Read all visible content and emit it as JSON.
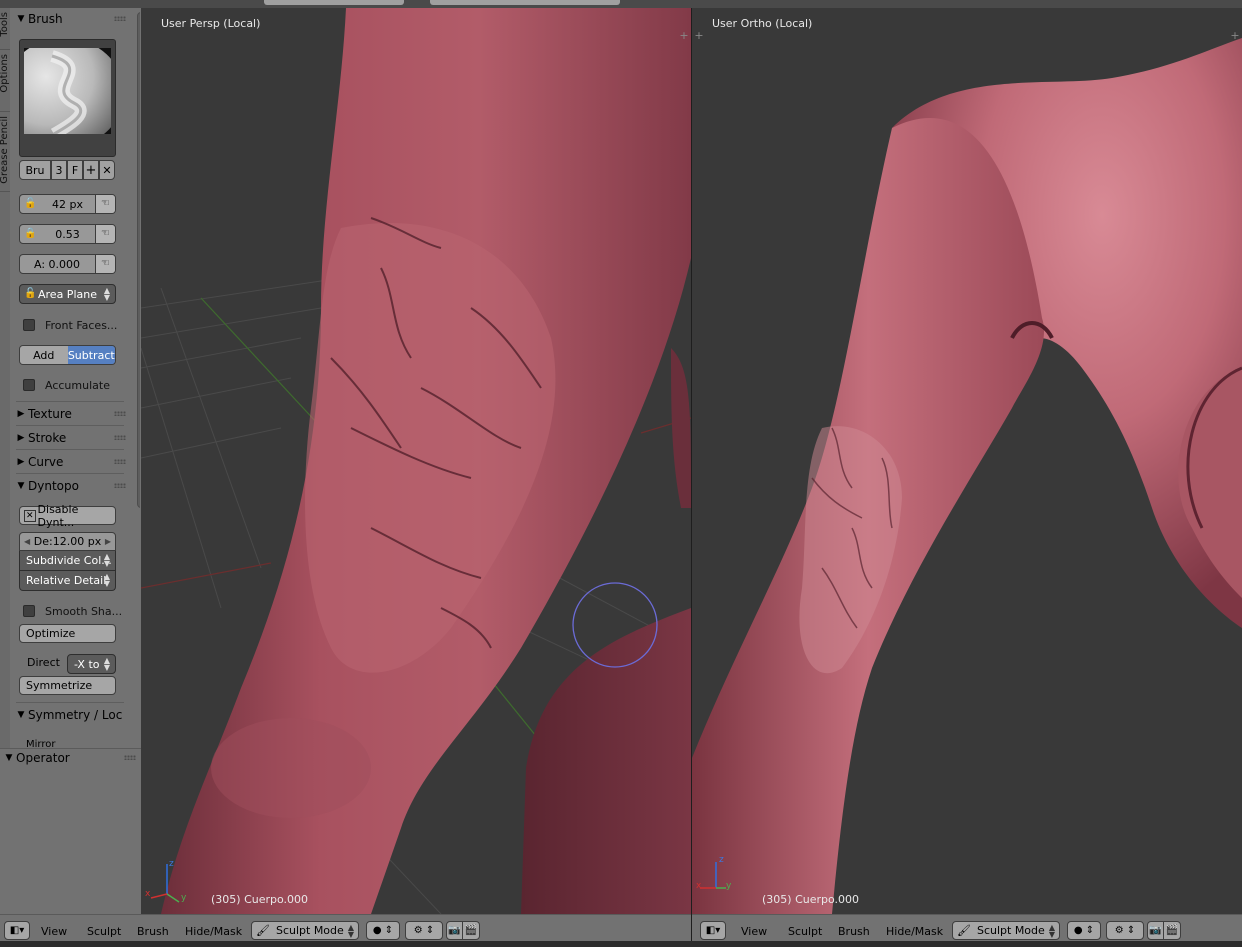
{
  "side_tabs": [
    "Tools",
    "Options",
    "Grease Pencil"
  ],
  "brush_panel": {
    "title": "Brush",
    "brush_name_short": "Bru",
    "users": "3",
    "fake_user": "F",
    "radius": "42 px",
    "strength": "0.53",
    "autosmooth": "A:  0.000",
    "sculpt_plane": "Area Plane",
    "front_faces_label": "Front Faces...",
    "add_label": "Add",
    "subtract_label": "Subtract",
    "accumulate_label": "Accumulate"
  },
  "collapsed_panels": [
    "Texture",
    "Stroke",
    "Curve"
  ],
  "dyntopo": {
    "title": "Dyntopo",
    "disable_label": "Disable Dynt...",
    "detail_size": "De:12.00 px",
    "method": "Subdivide Col...",
    "detail_type": "Relative Detail",
    "smooth_shading_label": "Smooth Sha...",
    "optimize_label": "Optimize",
    "direction_label": "Direct",
    "direction_value": "-X to",
    "symmetrize_label": "Symmetrize"
  },
  "symmetry_panel": {
    "title": "Symmetry / Loc",
    "mirror_label": "Mirror"
  },
  "operator_panel": {
    "title": "Operator"
  },
  "viewport_left": {
    "title": "User Persp (Local)",
    "object_info": "(305) Cuerpo.000"
  },
  "viewport_right": {
    "title": "User Ortho (Local)",
    "object_info": "(305) Cuerpo.000"
  },
  "header_menus": [
    "View",
    "Sculpt",
    "Brush",
    "Hide/Mask"
  ],
  "mode_label": "Sculpt Mode",
  "colors": {
    "skin": "#b05a6a",
    "viewport_bg": "#393939",
    "panel_bg": "#727272",
    "accent": "#5680c2"
  }
}
